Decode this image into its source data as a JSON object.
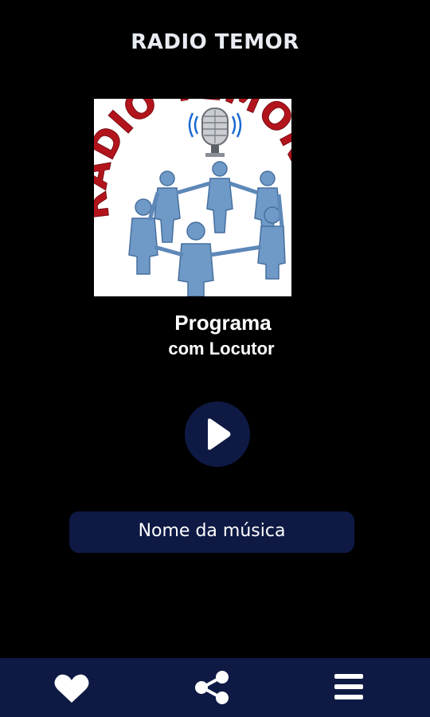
{
  "app": {
    "title": "RADIO TEMOR"
  },
  "logo": {
    "icon": "radio-temor-logo",
    "text": "RÁDIO TEMOR"
  },
  "program": {
    "title": "Programa",
    "subtitle": "com Locutor"
  },
  "player": {
    "play_icon": "play-icon",
    "song_name": "Nome da música"
  },
  "bottom_nav": {
    "items": [
      {
        "icon": "heart-icon"
      },
      {
        "icon": "share-icon"
      },
      {
        "icon": "menu-icon"
      }
    ]
  },
  "colors": {
    "background": "#000000",
    "accent": "#0e1a44",
    "logo_text": "#b3141c",
    "figures": "#6f9ac8",
    "text": "#ffffff"
  }
}
